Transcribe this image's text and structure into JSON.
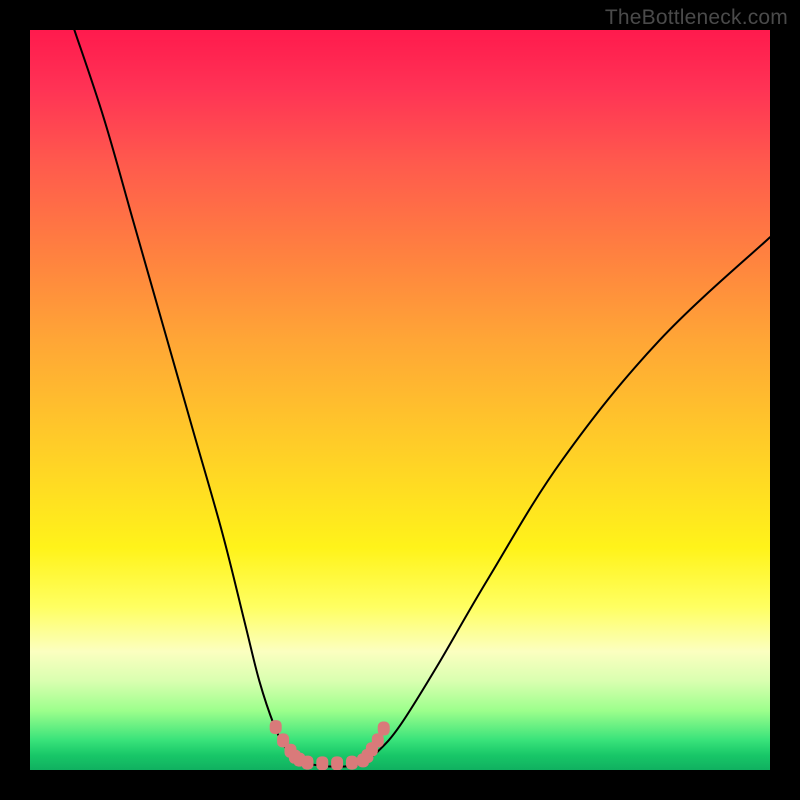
{
  "watermark": {
    "text": "TheBottleneck.com"
  },
  "chart_data": {
    "type": "line",
    "title": "",
    "xlabel": "",
    "ylabel": "",
    "xlim": [
      0,
      100
    ],
    "ylim": [
      0,
      100
    ],
    "grid": false,
    "legend": false,
    "series": [
      {
        "name": "left-curve",
        "x": [
          6,
          10,
          14,
          18,
          22,
          26,
          29,
          31,
          33,
          34.5,
          35.5,
          36.5
        ],
        "values": [
          100,
          88,
          74,
          60,
          46,
          32,
          20,
          12,
          6,
          3,
          1.5,
          1
        ]
      },
      {
        "name": "flat-bottom",
        "x": [
          36.5,
          40,
          43,
          45
        ],
        "values": [
          1,
          0.5,
          0.5,
          1
        ]
      },
      {
        "name": "right-curve",
        "x": [
          45,
          47,
          50,
          55,
          62,
          72,
          85,
          100
        ],
        "values": [
          1,
          2.5,
          6,
          14,
          26,
          42,
          58,
          72
        ]
      },
      {
        "name": "markers-left",
        "x": [
          33.2,
          34.2,
          35.2,
          35.8,
          36.4
        ],
        "values": [
          5.8,
          4.0,
          2.6,
          1.8,
          1.4
        ]
      },
      {
        "name": "markers-bottom",
        "x": [
          37.5,
          39.5,
          41.5,
          43.5
        ],
        "values": [
          1.0,
          0.9,
          0.9,
          1.0
        ]
      },
      {
        "name": "markers-right",
        "x": [
          45.0,
          45.6,
          46.2,
          47.0,
          47.8
        ],
        "values": [
          1.3,
          1.9,
          2.8,
          4.0,
          5.6
        ]
      }
    ],
    "colors": {
      "curve": "#000000",
      "marker": "#d97a7a"
    }
  }
}
